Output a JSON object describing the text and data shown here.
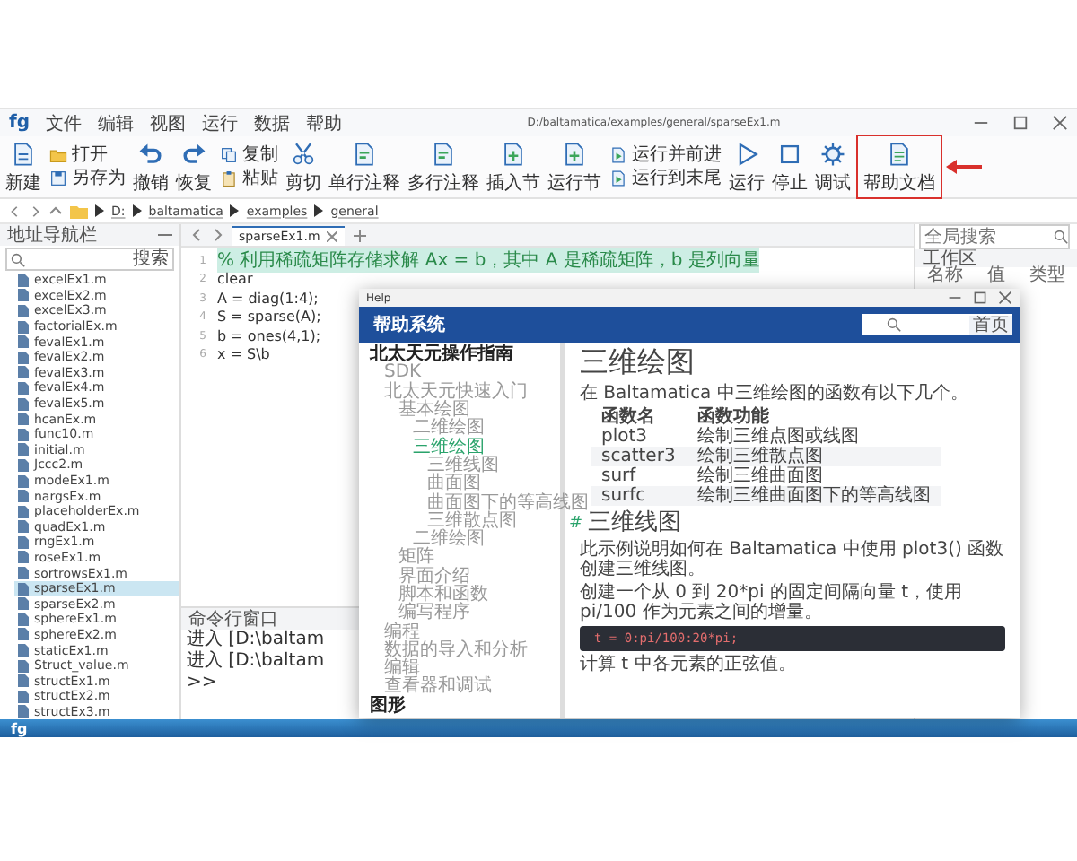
{
  "title_bar": {
    "logo": "fg",
    "menu": [
      "文件",
      "编辑",
      "视图",
      "运行",
      "数据",
      "帮助"
    ],
    "path": "D:/baltamatica/examples/general/sparseEx1.m"
  },
  "ribbon": [
    {
      "kind": "big",
      "items": [
        {
          "label": "新建",
          "highlighted": false
        }
      ]
    },
    {
      "kind": "stack",
      "items": [
        {
          "label": "打开",
          "highlighted": false
        },
        {
          "label": "另存为",
          "highlighted": false
        }
      ]
    },
    {
      "kind": "big",
      "items": [
        {
          "label": "撤销",
          "highlighted": false
        }
      ]
    },
    {
      "kind": "big",
      "items": [
        {
          "label": "恢复",
          "highlighted": false
        }
      ]
    },
    {
      "kind": "stack",
      "items": [
        {
          "label": "复制",
          "highlighted": false
        },
        {
          "label": "粘贴",
          "highlighted": false
        }
      ]
    },
    {
      "kind": "big",
      "items": [
        {
          "label": "剪切",
          "highlighted": false
        }
      ]
    },
    {
      "kind": "big",
      "items": [
        {
          "label": "单行注释",
          "highlighted": false
        }
      ]
    },
    {
      "kind": "big",
      "items": [
        {
          "label": "多行注释",
          "highlighted": false
        }
      ]
    },
    {
      "kind": "big",
      "items": [
        {
          "label": "插入节",
          "highlighted": false
        }
      ]
    },
    {
      "kind": "big",
      "items": [
        {
          "label": "运行节",
          "highlighted": false
        }
      ]
    },
    {
      "kind": "stack",
      "items": [
        {
          "label": "运行并前进",
          "highlighted": false
        },
        {
          "label": "运行到末尾",
          "highlighted": false
        }
      ]
    },
    {
      "kind": "big",
      "items": [
        {
          "label": "运行",
          "highlighted": false
        }
      ]
    },
    {
      "kind": "big",
      "items": [
        {
          "label": "停止",
          "highlighted": false
        }
      ]
    },
    {
      "kind": "big",
      "items": [
        {
          "label": "调试",
          "highlighted": false
        }
      ]
    },
    {
      "kind": "big",
      "items": [
        {
          "label": "帮助文档",
          "highlighted": true
        }
      ]
    }
  ],
  "path_bar": {
    "crumbs": [
      "D:",
      "baltamatica",
      "examples",
      "general"
    ]
  },
  "navigator": {
    "title": "地址导航栏",
    "search_button": "搜索",
    "files": [
      {
        "name": "excelEx1.m",
        "selected": false
      },
      {
        "name": "excelEx2.m",
        "selected": false
      },
      {
        "name": "excelEx3.m",
        "selected": false
      },
      {
        "name": "factorialEx.m",
        "selected": false
      },
      {
        "name": "fevalEx1.m",
        "selected": false
      },
      {
        "name": "fevalEx2.m",
        "selected": false
      },
      {
        "name": "fevalEx3.m",
        "selected": false
      },
      {
        "name": "fevalEx4.m",
        "selected": false
      },
      {
        "name": "fevalEx5.m",
        "selected": false
      },
      {
        "name": "hcanEx.m",
        "selected": false
      },
      {
        "name": "func10.m",
        "selected": false
      },
      {
        "name": "initial.m",
        "selected": false
      },
      {
        "name": "Jccc2.m",
        "selected": false
      },
      {
        "name": "modeEx1.m",
        "selected": false
      },
      {
        "name": "nargsEx.m",
        "selected": false
      },
      {
        "name": "placeholderEx.m",
        "selected": false
      },
      {
        "name": "quadEx1.m",
        "selected": false
      },
      {
        "name": "rngEx1.m",
        "selected": false
      },
      {
        "name": "roseEx1.m",
        "selected": false
      },
      {
        "name": "sortrowsEx1.m",
        "selected": false
      },
      {
        "name": "sparseEx1.m",
        "selected": true
      },
      {
        "name": "sparseEx2.m",
        "selected": false
      },
      {
        "name": "sphereEx1.m",
        "selected": false
      },
      {
        "name": "sphereEx2.m",
        "selected": false
      },
      {
        "name": "staticEx1.m",
        "selected": false
      },
      {
        "name": "Struct_value.m",
        "selected": false
      },
      {
        "name": "structEx1.m",
        "selected": false
      },
      {
        "name": "structEx2.m",
        "selected": false
      },
      {
        "name": "structEx3.m",
        "selected": false
      }
    ]
  },
  "editor": {
    "tab": "sparseEx1.m",
    "lines": [
      {
        "no": "1",
        "text": "% 利用稀疏矩阵存储求解 Ax = b，其中 A 是稀疏矩阵，b 是列向量",
        "kind": "comment"
      },
      {
        "no": "2",
        "text": "clear",
        "kind": "code"
      },
      {
        "no": "3",
        "text": "A = diag(1:4);",
        "kind": "code"
      },
      {
        "no": "4",
        "text": "S = sparse(A);",
        "kind": "code"
      },
      {
        "no": "5",
        "text": "b = ones(4,1);",
        "kind": "code"
      },
      {
        "no": "6",
        "text": "x = S\\b",
        "kind": "code"
      }
    ]
  },
  "command_window": {
    "title": "命令行窗口",
    "lines": [
      "进入 [D:\\baltam",
      "进入 [D:\\baltam",
      ">>"
    ]
  },
  "workspace": {
    "search_placeholder": "全局搜索",
    "title": "工作区",
    "columns": [
      "名称",
      "值",
      "类型"
    ]
  },
  "status_bar": {
    "logo": "fg"
  },
  "help": {
    "title": "Help",
    "brand": "帮助系统",
    "home_button": "首页",
    "nav": [
      {
        "label": "北太天元操作指南",
        "selected": false,
        "children": [
          {
            "label": "SDK",
            "selected": false
          },
          {
            "label": "北太天元快速入门",
            "selected": false,
            "children": [
              {
                "label": "基本绘图",
                "selected": false,
                "children": [
                  {
                    "label": "二维绘图",
                    "selected": false
                  },
                  {
                    "label": "三维绘图",
                    "selected": true,
                    "children": [
                      {
                        "label": "三维线图",
                        "selected": false
                      },
                      {
                        "label": "曲面图",
                        "selected": false
                      },
                      {
                        "label": "曲面图下的等高线图",
                        "selected": false
                      },
                      {
                        "label": "三维散点图",
                        "selected": false
                      }
                    ]
                  },
                  {
                    "label": "二维绘图",
                    "selected": false
                  }
                ]
              },
              {
                "label": "矩阵",
                "selected": false
              },
              {
                "label": "界面介绍",
                "selected": false
              },
              {
                "label": "脚本和函数",
                "selected": false
              },
              {
                "label": "编写程序",
                "selected": false
              }
            ]
          },
          {
            "label": "编程",
            "selected": false
          },
          {
            "label": "数据的导入和分析",
            "selected": false
          },
          {
            "label": "编辑",
            "selected": false
          },
          {
            "label": "查看器和调试",
            "selected": false
          }
        ]
      },
      {
        "label": "图形",
        "selected": false
      }
    ],
    "content": {
      "title": "三维绘图",
      "intro": "在 Baltamatica 中三维绘图的函数有以下几个。",
      "table": {
        "columns": [
          "函数名",
          "函数功能"
        ],
        "rows": [
          [
            "plot3",
            "绘制三维点图或线图"
          ],
          [
            "scatter3",
            "绘制三维散点图"
          ],
          [
            "surf",
            "绘制三维曲面图"
          ],
          [
            "surfc",
            "绘制三维曲面图下的等高线图"
          ]
        ]
      },
      "section_mark": "#",
      "section_title": "三维线图",
      "paragraphs": [
        "此示例说明如何在 Baltamatica 中使用 plot3() 函数创建三维线图。",
        "创建一个从 0 到 20*pi 的固定间隔向量 t，使用 pi/100 作为元素之间的增量。"
      ],
      "code": "t = 0:pi/100:20*pi;",
      "last": "计算 t 中各元素的正弦值。"
    }
  }
}
